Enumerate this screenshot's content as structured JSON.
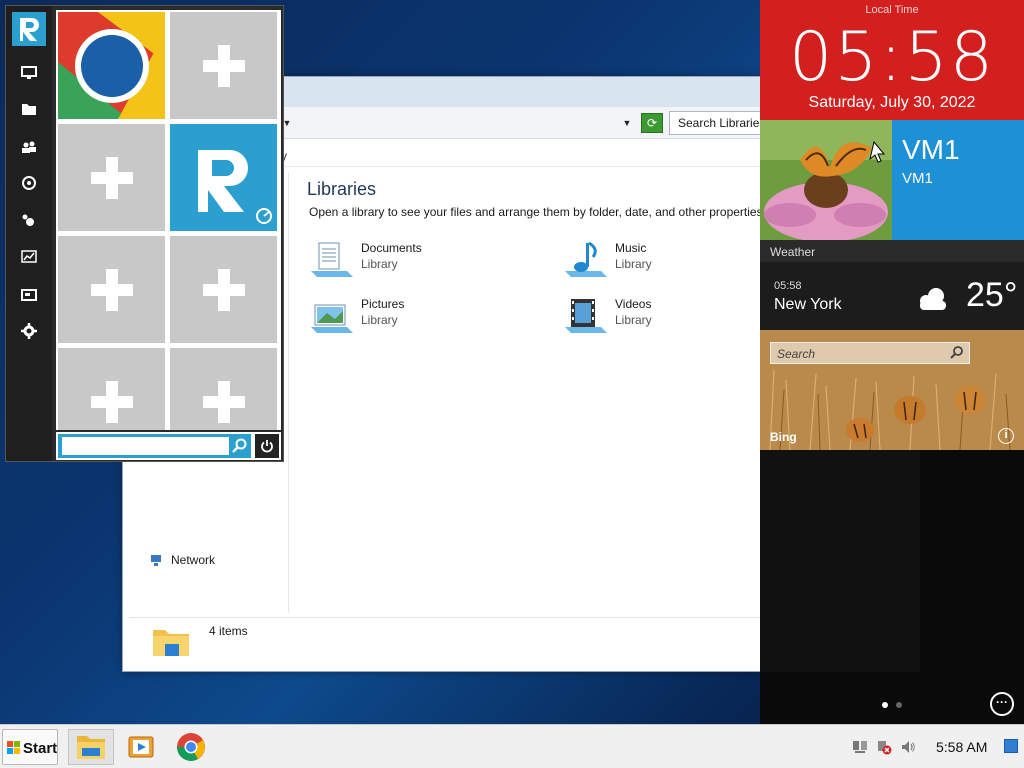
{
  "explorer": {
    "search_placeholder": "Search Libraries",
    "menu_fragment": "y",
    "heading": "Libraries",
    "subtitle": "Open a library to see your files and arrange them by folder, date, and other properties.",
    "libraries": [
      {
        "name": "Documents",
        "type": "Library",
        "icon": "documents-library-icon"
      },
      {
        "name": "Music",
        "type": "Library",
        "icon": "music-library-icon"
      },
      {
        "name": "Pictures",
        "type": "Library",
        "icon": "pictures-library-icon"
      },
      {
        "name": "Videos",
        "type": "Library",
        "icon": "videos-library-icon"
      }
    ],
    "nav_network": "Network",
    "status_count": "4 items"
  },
  "start_menu": {
    "rail_icons": [
      "computer-icon",
      "folder-icon",
      "users-icon",
      "network-icon",
      "settings-gear-icon",
      "performance-chart-icon",
      "display-icon",
      "settings-icon"
    ],
    "tiles": [
      "chrome-tile",
      "add-tile",
      "add-tile",
      "app-tile",
      "add-tile",
      "add-tile",
      "add-tile",
      "add-tile"
    ],
    "search_value": ""
  },
  "right_panel": {
    "clock_label": "Local Time",
    "clock_time": "05:58",
    "clock_date": "Saturday, July 30, 2022",
    "vm_title": "VM1",
    "vm_subtitle": "VM1",
    "weather_label": "Weather",
    "weather_time": "05:58",
    "weather_city": "New York",
    "weather_temp": "25°",
    "bing_search_placeholder": "Search",
    "bing_label": "Bing",
    "bing_info": "i",
    "more_button": "···"
  },
  "taskbar": {
    "start_label": "Start",
    "apps": [
      "file-explorer-icon",
      "media-player-icon",
      "chrome-icon"
    ],
    "clock": "5:58 AM"
  },
  "colors": {
    "clock_red": "#d41f1f",
    "vm_blue": "#1e90d6",
    "accent_blue": "#2b9fd0",
    "tile_gray": "#c8c8c8"
  }
}
